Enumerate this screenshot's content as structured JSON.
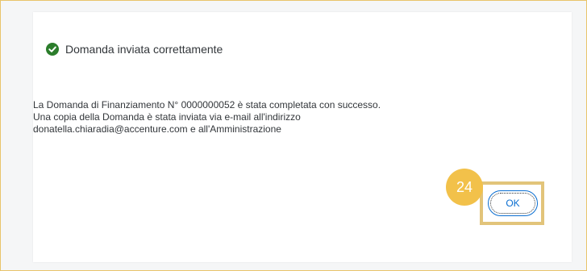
{
  "dialog": {
    "status_text": "Domanda inviata correttamente",
    "status_icon": "check-circle-icon",
    "status_color": "#2b7d2b",
    "message_lines": [
      "La Domanda di Finanziamento N° 0000000052 è stata completata con successo.",
      "Una copia della Domanda è stata inviata via e-mail all'indirizzo",
      "donatella.chiaradia@accenture.com e all'Amministrazione"
    ],
    "ok_label": "OK"
  },
  "annotation": {
    "step_number": "24",
    "badge_color": "#f2c14a",
    "highlight_color": "#e2c47a"
  },
  "theme": {
    "accent": "#0a6ed1",
    "page_bg": "#f5f6f7"
  }
}
